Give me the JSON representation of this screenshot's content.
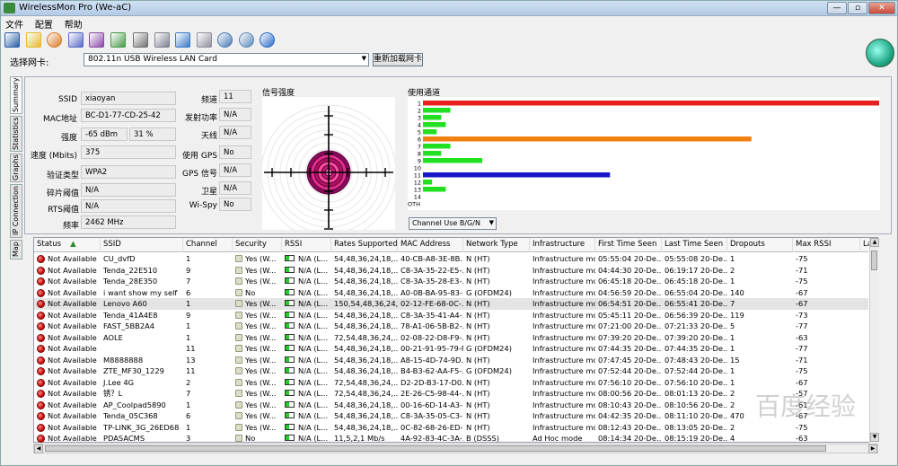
{
  "window": {
    "title": "WirelessMon Pro (We-aC)",
    "minimize": "—",
    "maximize": "▫",
    "close": "✕"
  },
  "menu": [
    "文件",
    "配置",
    "帮助"
  ],
  "toolbar": [
    {
      "icon": "save-icon",
      "color": "#2a5fa8"
    },
    {
      "icon": "open-folder-icon",
      "color": "#e8b830"
    },
    {
      "icon": "globe-icon",
      "color": "#d87a20"
    },
    {
      "icon": "network-icon",
      "color": "#5a6ac8"
    },
    {
      "icon": "network-alt-icon",
      "color": "#8a4aa8"
    },
    {
      "icon": "export-icon",
      "color": "#4a9a4a"
    },
    {
      "icon": "print-icon",
      "color": "#707070"
    },
    {
      "icon": "print-preview-icon",
      "color": "#808090"
    },
    {
      "icon": "check-icon",
      "color": "#3a7ac8"
    },
    {
      "icon": "clipboard-icon",
      "color": "#9090a0"
    },
    {
      "icon": "settings-icon",
      "color": "#4a7ab8"
    },
    {
      "icon": "web-icon",
      "color": "#5a8ab8"
    },
    {
      "icon": "help-icon",
      "color": "#2a6ac8"
    }
  ],
  "card": {
    "label": "选择网卡:",
    "selected": "802.11n USB Wireless LAN Card",
    "reload": "重新加载网卡"
  },
  "side_tabs": [
    "Summary",
    "Statistics",
    "Graphs",
    "IP Connection",
    "Map"
  ],
  "summary": {
    "ssid_label": "SSID",
    "ssid": "xiaoyan",
    "mac_label": "MAC地址",
    "mac": "BC-D1-77-CD-25-42",
    "strength_label": "强度",
    "strength_dbm": "-65 dBm",
    "strength_pct": "31 %",
    "speed_label": "速度 (Mbits)",
    "speed": "375",
    "auth_label": "验证类型",
    "auth": "WPA2",
    "frag_label": "碎片阈值",
    "frag": "N/A",
    "rts_label": "RTS阈值",
    "rts": "N/A",
    "freq_label": "频率",
    "freq": "2462 MHz",
    "channel_label": "频道",
    "channel": "11",
    "txpower_label": "发射功率",
    "txpower": "N/A",
    "antenna_label": "天线",
    "antenna": "N/A",
    "gps_label": "使用 GPS",
    "gps": "No",
    "gps_signal_label": "GPS 信号",
    "gps_signal": "N/A",
    "satellite_label": "卫星",
    "satellite": "N/A",
    "wispy_label": "Wi-Spy",
    "wispy": "No",
    "signal_title": "信号强度",
    "channel_title": "使用通道",
    "channel_select": "Channel Use B/G/N"
  },
  "channel_use": {
    "labels": [
      "1",
      "2",
      "3",
      "4",
      "5",
      "6",
      "7",
      "8",
      "9",
      "10",
      "11",
      "12",
      "13",
      "14",
      "OTH"
    ],
    "values": [
      100,
      6,
      4,
      5,
      3,
      72,
      6,
      4,
      13,
      0,
      41,
      2,
      5,
      0,
      0
    ],
    "highlight": {
      "1": "#e82020",
      "6": "#f08010",
      "11": "#1818c8"
    },
    "default_color": "#20e020"
  },
  "table": {
    "columns": [
      "Status",
      "SSID",
      "Channel",
      "Security",
      "RSSI",
      "Rates Supported",
      "MAC Address",
      "Network Type",
      "Infrastructure",
      "First Time Seen",
      "Last Time Seen",
      "Dropouts",
      "Max RSSI",
      "La"
    ],
    "sort_icon": "sort-up-icon",
    "rows": [
      [
        "Not Available",
        "CU_dvfD",
        "1",
        "Yes (W...",
        "N/A (L...",
        "54,48,36,24,18,...",
        "40-CB-A8-3E-8B...",
        "N (HT)",
        "Infrastructure mo...",
        "05:55:04 20-De...",
        "05:55:08 20-De...",
        "1",
        "-75"
      ],
      [
        "Not Available",
        "Tenda_22E510",
        "9",
        "Yes (W...",
        "N/A (L...",
        "54,48,36,24,18,...",
        "C8-3A-35-22-E5-...",
        "N (HT)",
        "Infrastructure mo...",
        "04:44:30 20-De...",
        "06:19:17 20-De...",
        "2",
        "-71"
      ],
      [
        "Not Available",
        "Tenda_28E350",
        "7",
        "Yes (W...",
        "N/A (L...",
        "54,48,36,24,18,...",
        "C8-3A-35-28-E3-...",
        "N (HT)",
        "Infrastructure mo...",
        "06:45:18 20-De...",
        "06:45:18 20-De...",
        "1",
        "-75"
      ],
      [
        "Not Available",
        "i want show my self",
        "6",
        "No",
        "N/A (L...",
        "54,48,36,24,18,...",
        "A0-0B-BA-95-83-...",
        "G (OFDM24)",
        "Infrastructure mo...",
        "04:56:59 20-De...",
        "06:55:04 20-De...",
        "140",
        "-67"
      ],
      [
        "Not Available",
        "Lenovo A60",
        "1",
        "Yes (W...",
        "N/A (L...",
        "150,54,48,36,24,...",
        "02-12-FE-68-0C-...",
        "N (HT)",
        "Infrastructure mo...",
        "06:54:51 20-De...",
        "06:55:41 20-De...",
        "7",
        "-67"
      ],
      [
        "Not Available",
        "Tenda_41A4E8",
        "9",
        "Yes (W...",
        "N/A (L...",
        "54,48,36,24,18,...",
        "C8-3A-35-41-A4-...",
        "N (HT)",
        "Infrastructure mo...",
        "05:45:11 20-De...",
        "06:56:39 20-De...",
        "119",
        "-73"
      ],
      [
        "Not Available",
        "FAST_5BB2A4",
        "1",
        "Yes (W...",
        "N/A (L...",
        "54,48,36,24,18,...",
        "78-A1-06-5B-B2-...",
        "N (HT)",
        "Infrastructure mo...",
        "07:21:00 20-De...",
        "07:21:33 20-De...",
        "5",
        "-77"
      ],
      [
        "Not Available",
        "AOLE",
        "1",
        "Yes (W...",
        "N/A (L...",
        "72,54,48,36,24,...",
        "02-08-22-D8-F9-...",
        "N (HT)",
        "Infrastructure mo...",
        "07:39:20 20-De...",
        "07:39:20 20-De...",
        "1",
        "-63"
      ],
      [
        "Not Available",
        "",
        "11",
        "Yes (W...",
        "N/A (L...",
        "54,48,36,24,18,...",
        "00-21-91-95-79-F2",
        "G (OFDM24)",
        "Infrastructure mo...",
        "07:44:35 20-De...",
        "07:44:35 20-De...",
        "1",
        "-77"
      ],
      [
        "Not Available",
        "M8888888",
        "13",
        "Yes (W...",
        "N/A (L...",
        "54,48,36,24,18,...",
        "A8-15-4D-74-9D...",
        "N (HT)",
        "Infrastructure mo...",
        "07:47:45 20-De...",
        "07:48:43 20-De...",
        "15",
        "-71"
      ],
      [
        "Not Available",
        "ZTE_MF30_1229",
        "11",
        "Yes (W...",
        "N/A (L...",
        "54,48,36,24,18,...",
        "B4-B3-62-AA-F5-...",
        "G (OFDM24)",
        "Infrastructure mo...",
        "07:52:44 20-De...",
        "07:52:44 20-De...",
        "1",
        "-75"
      ],
      [
        "Not Available",
        "J.Lee 4G",
        "2",
        "Yes (W...",
        "N/A (L...",
        "72,54,48,36,24,...",
        "D2-2D-B3-17-D0...",
        "N (HT)",
        "Infrastructure mo...",
        "07:56:10 20-De...",
        "07:56:10 20-De...",
        "1",
        "-67"
      ],
      [
        "Not Available",
        "锈？L",
        "7",
        "Yes (W...",
        "N/A (L...",
        "72,54,48,36,24,...",
        "2E-26-C5-98-44-...",
        "N (HT)",
        "Infrastructure mo...",
        "08:00:56 20-De...",
        "08:01:13 20-De...",
        "2",
        "-57"
      ],
      [
        "Not Available",
        "AP_Coolpad5890",
        "1",
        "Yes (W...",
        "N/A (L...",
        "54,48,36,24,18,...",
        "00-16-6D-14-A3-...",
        "N (HT)",
        "Infrastructure mo...",
        "08:10:43 20-De...",
        "08:10:56 20-De...",
        "2",
        "-61"
      ],
      [
        "Not Available",
        "Tenda_05C368",
        "6",
        "Yes (W...",
        "N/A (L...",
        "54,48,36,24,18,...",
        "C8-3A-35-05-C3-...",
        "N (HT)",
        "Infrastructure mo...",
        "04:42:35 20-De...",
        "08:11:10 20-De...",
        "470",
        "-67"
      ],
      [
        "Not Available",
        "TP-LINK_3G_26ED68",
        "1",
        "Yes (W...",
        "N/A (L...",
        "54,48,36,24,18,...",
        "0C-82-68-26-ED-...",
        "N (HT)",
        "Infrastructure mo...",
        "08:12:43 20-De...",
        "08:13:05 20-De...",
        "2",
        "-75"
      ],
      [
        "Not Available",
        "PDASACMS",
        "3",
        "No",
        "N/A (L...",
        "11,5,2,1 Mb/s",
        "4A-92-83-4C-3A-...",
        "B (DSSS)",
        "Ad Hoc mode",
        "08:14:34 20-De...",
        "08:15:19 20-De...",
        "4",
        "-63"
      ]
    ],
    "selected_row": 4
  },
  "watermark": "百度经验"
}
